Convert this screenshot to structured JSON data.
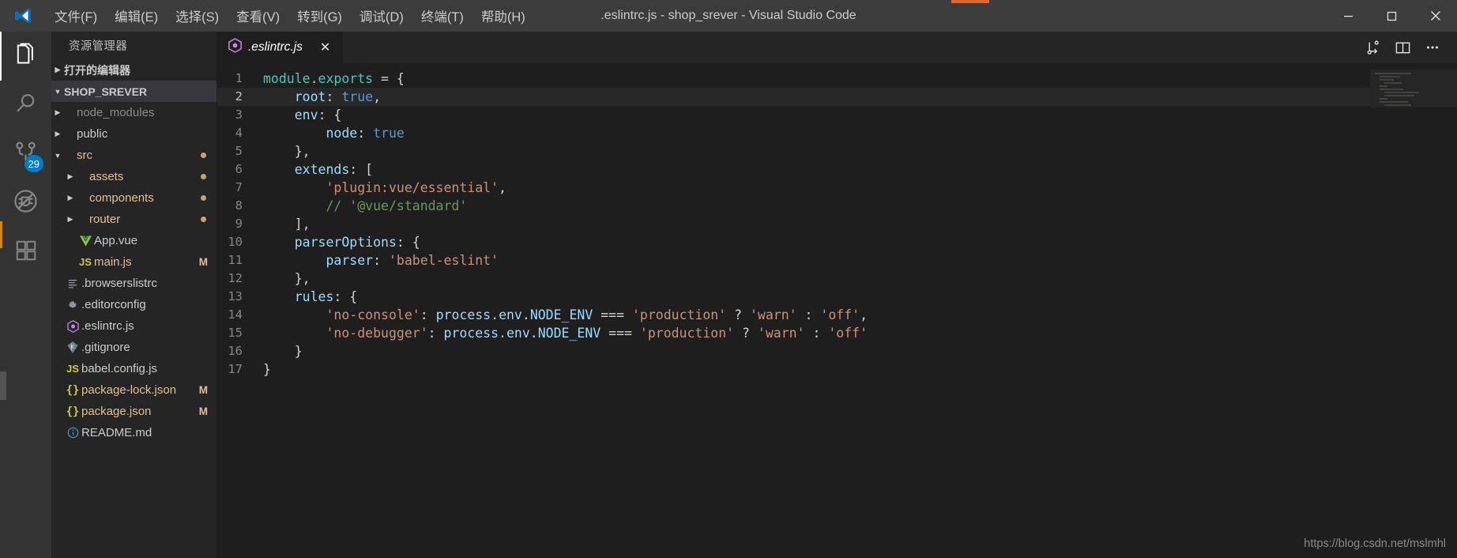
{
  "window": {
    "title": ".eslintrc.js - shop_srever - Visual Studio Code",
    "minimize_icon": "minimize-icon",
    "maximize_icon": "maximize-icon",
    "close_icon": "close-icon"
  },
  "menubar": {
    "items": [
      {
        "label": "文件(F)"
      },
      {
        "label": "编辑(E)"
      },
      {
        "label": "选择(S)"
      },
      {
        "label": "查看(V)"
      },
      {
        "label": "转到(G)"
      },
      {
        "label": "调试(D)"
      },
      {
        "label": "终端(T)"
      },
      {
        "label": "帮助(H)"
      }
    ]
  },
  "activitybar": {
    "items": [
      {
        "name": "explorer-icon",
        "active": true,
        "badge": ""
      },
      {
        "name": "search-icon",
        "active": false,
        "badge": ""
      },
      {
        "name": "source-control-icon",
        "active": false,
        "badge": "29"
      },
      {
        "name": "run-debug-icon",
        "active": false,
        "badge": ""
      },
      {
        "name": "extensions-icon",
        "active": false,
        "badge": ""
      }
    ],
    "source_control_badge": "29"
  },
  "sidebar": {
    "title": "资源管理器",
    "open_editors_label": "打开的编辑器",
    "project_label": "SHOP_SREVER",
    "tree": [
      {
        "label": "node_modules",
        "icon": "",
        "indent": 1,
        "twisty": "collapsed",
        "color": "dim",
        "badge": ""
      },
      {
        "label": "public",
        "icon": "",
        "indent": 1,
        "twisty": "collapsed",
        "color": "white",
        "badge": ""
      },
      {
        "label": "src",
        "icon": "",
        "indent": 1,
        "twisty": "expanded",
        "color": "tan",
        "badge": "dot"
      },
      {
        "label": "assets",
        "icon": "",
        "indent": 2,
        "twisty": "collapsed",
        "color": "tan",
        "badge": "dot"
      },
      {
        "label": "components",
        "icon": "",
        "indent": 2,
        "twisty": "collapsed",
        "color": "tan",
        "badge": "dot"
      },
      {
        "label": "router",
        "icon": "",
        "indent": 2,
        "twisty": "collapsed",
        "color": "tan",
        "badge": "dot"
      },
      {
        "label": "App.vue",
        "icon": "vue-icon",
        "indent": 2,
        "twisty": "none",
        "color": "white",
        "badge": ""
      },
      {
        "label": "main.js",
        "icon": "js-icon",
        "indent": 2,
        "twisty": "none",
        "color": "tan",
        "badge": "M"
      },
      {
        "label": ".browserslistrc",
        "icon": "list-icon",
        "indent": 1,
        "twisty": "none",
        "color": "white",
        "badge": ""
      },
      {
        "label": ".editorconfig",
        "icon": "gear-icon",
        "indent": 1,
        "twisty": "none",
        "color": "white",
        "badge": ""
      },
      {
        "label": ".eslintrc.js",
        "icon": "eslint-icon",
        "indent": 1,
        "twisty": "none",
        "color": "white",
        "badge": ""
      },
      {
        "label": ".gitignore",
        "icon": "git-icon",
        "indent": 1,
        "twisty": "none",
        "color": "white",
        "badge": ""
      },
      {
        "label": "babel.config.js",
        "icon": "js-icon",
        "indent": 1,
        "twisty": "none",
        "color": "white",
        "badge": ""
      },
      {
        "label": "package-lock.json",
        "icon": "json-icon",
        "indent": 1,
        "twisty": "none",
        "color": "tan",
        "badge": "M"
      },
      {
        "label": "package.json",
        "icon": "json-icon",
        "indent": 1,
        "twisty": "none",
        "color": "tan",
        "badge": "M"
      },
      {
        "label": "README.md",
        "icon": "info-icon",
        "indent": 1,
        "twisty": "none",
        "color": "white",
        "badge": ""
      }
    ]
  },
  "editor": {
    "tab": {
      "label": ".eslintrc.js",
      "icon": "eslint-icon",
      "close_icon": "close-icon"
    },
    "actions": [
      {
        "name": "run-file-icon"
      },
      {
        "name": "split-editor-icon"
      },
      {
        "name": "more-actions-icon"
      }
    ],
    "lines": [
      {
        "n": "1",
        "tokens": [
          {
            "t": "module",
            "c": "green"
          },
          {
            "t": ".",
            "c": "white"
          },
          {
            "t": "exports",
            "c": "green"
          },
          {
            "t": " = {",
            "c": "white"
          }
        ]
      },
      {
        "n": "2",
        "tokens": [
          {
            "t": "    ",
            "c": "white"
          },
          {
            "t": "root",
            "c": "blue"
          },
          {
            "t": ": ",
            "c": "white"
          },
          {
            "t": "true",
            "c": "lblue"
          },
          {
            "t": ",",
            "c": "white"
          }
        ]
      },
      {
        "n": "3",
        "tokens": [
          {
            "t": "    ",
            "c": "white"
          },
          {
            "t": "env",
            "c": "blue"
          },
          {
            "t": ": {",
            "c": "white"
          }
        ]
      },
      {
        "n": "4",
        "tokens": [
          {
            "t": "        ",
            "c": "white"
          },
          {
            "t": "node",
            "c": "blue"
          },
          {
            "t": ": ",
            "c": "white"
          },
          {
            "t": "true",
            "c": "lblue"
          }
        ]
      },
      {
        "n": "5",
        "tokens": [
          {
            "t": "    },",
            "c": "white"
          }
        ]
      },
      {
        "n": "6",
        "tokens": [
          {
            "t": "    ",
            "c": "white"
          },
          {
            "t": "extends",
            "c": "blue"
          },
          {
            "t": ": [",
            "c": "white"
          }
        ]
      },
      {
        "n": "7",
        "tokens": [
          {
            "t": "        ",
            "c": "white"
          },
          {
            "t": "'plugin:vue/essential'",
            "c": "orange"
          },
          {
            "t": ",",
            "c": "white"
          }
        ]
      },
      {
        "n": "8",
        "tokens": [
          {
            "t": "        ",
            "c": "white"
          },
          {
            "t": "// '@vue/standard'",
            "c": "cmt"
          }
        ]
      },
      {
        "n": "9",
        "tokens": [
          {
            "t": "    ],",
            "c": "white"
          }
        ]
      },
      {
        "n": "10",
        "tokens": [
          {
            "t": "    ",
            "c": "white"
          },
          {
            "t": "parserOptions",
            "c": "blue"
          },
          {
            "t": ": {",
            "c": "white"
          }
        ]
      },
      {
        "n": "11",
        "tokens": [
          {
            "t": "        ",
            "c": "white"
          },
          {
            "t": "parser",
            "c": "blue"
          },
          {
            "t": ": ",
            "c": "white"
          },
          {
            "t": "'babel-eslint'",
            "c": "orange"
          }
        ]
      },
      {
        "n": "12",
        "tokens": [
          {
            "t": "    },",
            "c": "white"
          }
        ]
      },
      {
        "n": "13",
        "tokens": [
          {
            "t": "    ",
            "c": "white"
          },
          {
            "t": "rules",
            "c": "blue"
          },
          {
            "t": ": {",
            "c": "white"
          }
        ]
      },
      {
        "n": "14",
        "tokens": [
          {
            "t": "        ",
            "c": "white"
          },
          {
            "t": "'no-console'",
            "c": "orange"
          },
          {
            "t": ": ",
            "c": "white"
          },
          {
            "t": "process",
            "c": "blue"
          },
          {
            "t": ".",
            "c": "white"
          },
          {
            "t": "env",
            "c": "blue"
          },
          {
            "t": ".",
            "c": "white"
          },
          {
            "t": "NODE_ENV",
            "c": "blue"
          },
          {
            "t": " === ",
            "c": "white"
          },
          {
            "t": "'production'",
            "c": "orange"
          },
          {
            "t": " ? ",
            "c": "white"
          },
          {
            "t": "'warn'",
            "c": "orange"
          },
          {
            "t": " : ",
            "c": "white"
          },
          {
            "t": "'off'",
            "c": "orange"
          },
          {
            "t": ",",
            "c": "white"
          }
        ]
      },
      {
        "n": "15",
        "tokens": [
          {
            "t": "        ",
            "c": "white"
          },
          {
            "t": "'no-debugger'",
            "c": "orange"
          },
          {
            "t": ": ",
            "c": "white"
          },
          {
            "t": "process",
            "c": "blue"
          },
          {
            "t": ".",
            "c": "white"
          },
          {
            "t": "env",
            "c": "blue"
          },
          {
            "t": ".",
            "c": "white"
          },
          {
            "t": "NODE_ENV",
            "c": "blue"
          },
          {
            "t": " === ",
            "c": "white"
          },
          {
            "t": "'production'",
            "c": "orange"
          },
          {
            "t": " ? ",
            "c": "white"
          },
          {
            "t": "'warn'",
            "c": "orange"
          },
          {
            "t": " : ",
            "c": "white"
          },
          {
            "t": "'off'",
            "c": "orange"
          }
        ]
      },
      {
        "n": "16",
        "tokens": [
          {
            "t": "    }",
            "c": "white"
          }
        ]
      },
      {
        "n": "17",
        "tokens": [
          {
            "t": "}",
            "c": "white"
          }
        ]
      }
    ]
  },
  "watermark": "https://blog.csdn.net/mslmhl",
  "colors": {
    "accent": "#007acc",
    "modified": "#e2c08d",
    "titlebar_bg": "#3c3c3c",
    "sidebar_bg": "#252526",
    "editor_bg": "#1e1e1e",
    "activitybar_bg": "#333333"
  }
}
